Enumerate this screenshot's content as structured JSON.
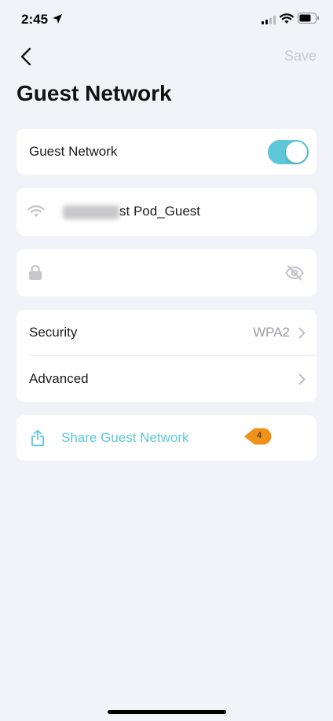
{
  "status_bar": {
    "time": "2:45"
  },
  "nav": {
    "save_label": "Save"
  },
  "page": {
    "title": "Guest Network"
  },
  "guest_toggle": {
    "label": "Guest Network",
    "enabled": true
  },
  "ssid": {
    "blurred_prefix_placeholder": "",
    "visible_suffix": "st Pod_Guest"
  },
  "password": {
    "value": ""
  },
  "settings": {
    "security_label": "Security",
    "security_value": "WPA2",
    "advanced_label": "Advanced"
  },
  "share": {
    "label": "Share Guest Network",
    "badge": "4"
  },
  "colors": {
    "accent": "#5ec8d9",
    "badge": "#f0921a",
    "background": "#f2f3f8"
  }
}
